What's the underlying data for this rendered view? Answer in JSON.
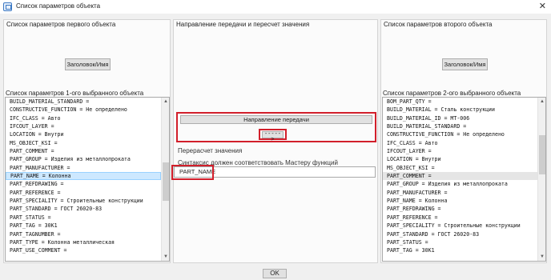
{
  "window": {
    "title": "Список параметров объекта",
    "close_glyph": "✕"
  },
  "left_panel": {
    "group_label": "Список параметров первого объекта",
    "header_button": "Заголовок/Имя",
    "list_label": "Список параметров 1-ого выбранного объекта",
    "items": [
      "BUILD_MATERIAL_STANDARD =",
      "CONSTRUCTIVE_FUNCTION = Не определено",
      "IFC_CLASS = Авто",
      "IFCOUT_LAYER =",
      "LOCATION = Внутри",
      "MS_OBJECT_KSI =",
      "PART_COMMENT =",
      "PART_GROUP = Изделия из металлопроката",
      "PART_MANUFACTURER =",
      "PART_NAME = Колонна",
      "PART_REFDRAWING =",
      "PART_REFERENCE =",
      "PART_SPECIALITY = Строительные конструкции",
      "PART_STANDARD = ГОСТ 26020-83",
      "PART_STATUS =",
      "PART_TAG = 30К1",
      "PART_TAGNUMBER =",
      "PART_TYPE = Колонна металлическая",
      "PART_USE_COMMENT ="
    ],
    "selected_index": 9
  },
  "middle_panel": {
    "group_label": "Направление передачи и пересчет значения",
    "transfer_button": "Направление передачи",
    "arrow_button": "----->",
    "recalc_label": "Перерасчет значения",
    "syntax_label": "Синтаксис должен соответствовать Мастеру функций",
    "formula_value": "PART_NAME"
  },
  "right_panel": {
    "group_label": "Список параметров второго объекта",
    "header_button": "Заголовок/Имя",
    "list_label": "Список параметров 2-ого выбранного объекта",
    "items": [
      "BOM_PART_QTY =",
      "BUILD_MATERIAL = Сталь конструкции",
      "BUILD_MATERIAL_ID = MT-006",
      "BUILD_MATERIAL_STANDARD =",
      "CONSTRUCTIVE_FUNCTION = Не определено",
      "IFC_CLASS = Авто",
      "IFCOUT_LAYER =",
      "LOCATION = Внутри",
      "MS_OBJECT_KSI =",
      "PART_COMMENT =",
      "PART_GROUP = Изделия из металлопроката",
      "PART_MANUFACTURER =",
      "PART_NAME = Колонна",
      "PART_REFDRAWING =",
      "PART_REFERENCE =",
      "PART_SPECIALITY = Строительные конструкции",
      "PART_STANDARD = ГОСТ 26020-83",
      "PART_STATUS =",
      "PART_TAG = 30К1"
    ],
    "highlighted_index": 9
  },
  "footer": {
    "ok_button": "OK"
  },
  "colors": {
    "annotation_red": "#d21f2b",
    "selection_blue": "#cde8ff",
    "dialog_bg": "#f0f0f0"
  },
  "scroll": {
    "left_thumb_top": 0.38,
    "left_thumb_size": 0.26,
    "right_thumb_top": 0.2,
    "right_thumb_size": 0.26
  }
}
